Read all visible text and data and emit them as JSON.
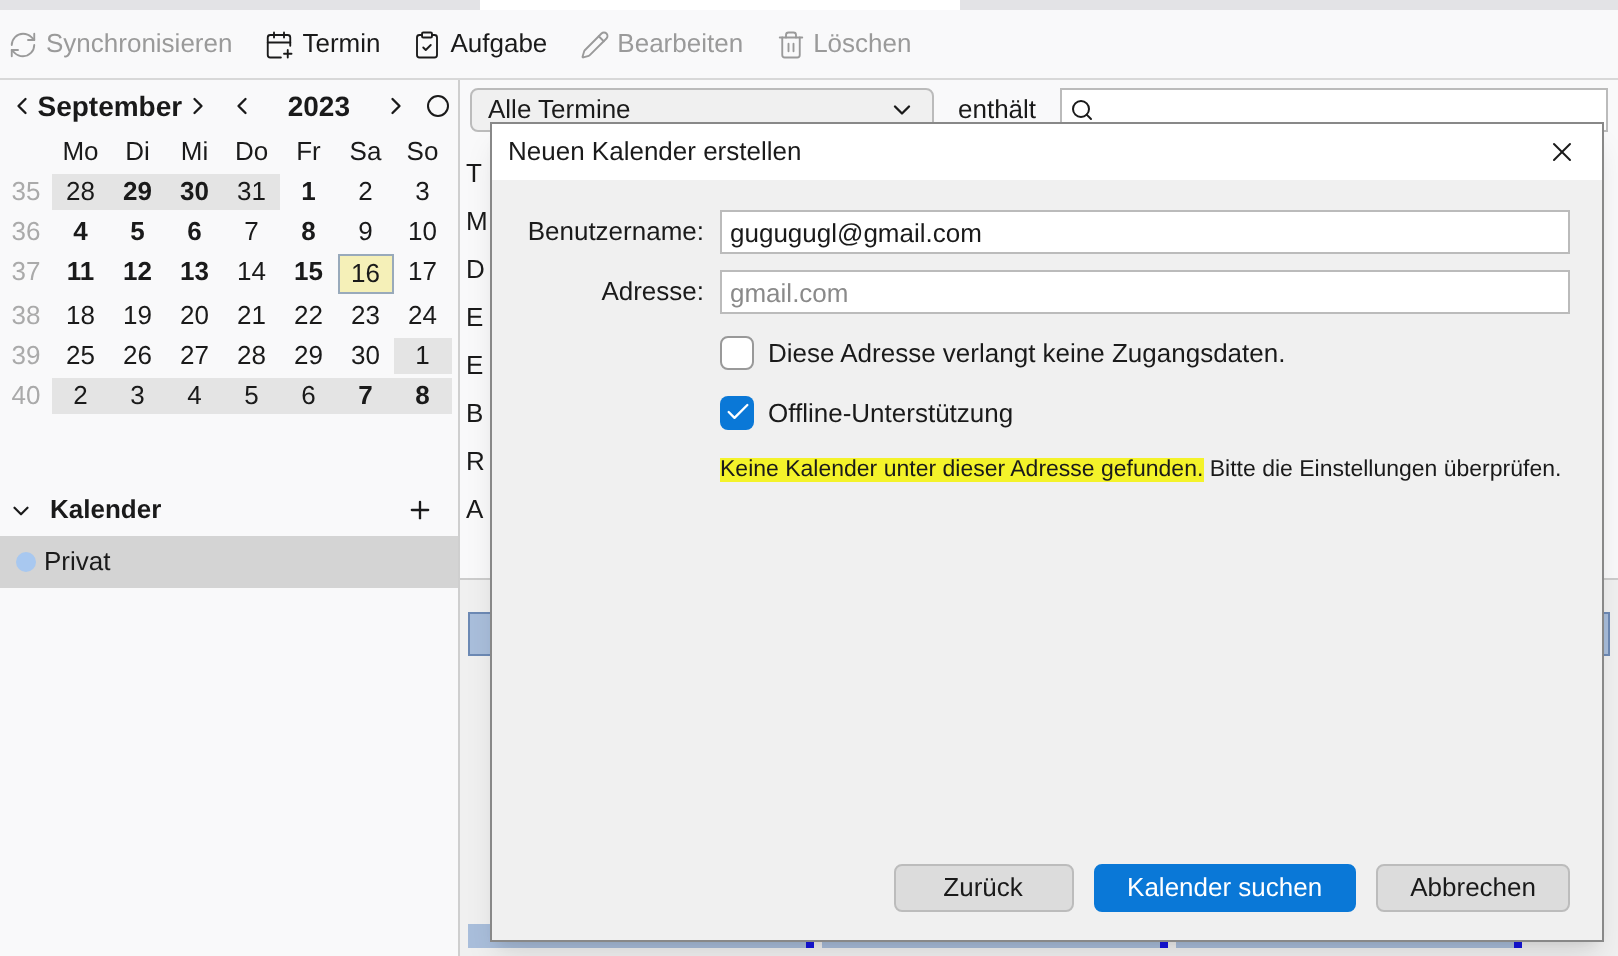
{
  "toolbar": [
    {
      "label": "Synchronisieren",
      "disabled": true
    },
    {
      "label": "Termin",
      "disabled": false
    },
    {
      "label": "Aufgabe",
      "disabled": false
    },
    {
      "label": "Bearbeiten",
      "disabled": true
    },
    {
      "label": "Löschen",
      "disabled": true
    }
  ],
  "minical": {
    "month": "September",
    "year": "2023",
    "weekdays": [
      "Mo",
      "Di",
      "Mi",
      "Do",
      "Fr",
      "Sa",
      "So"
    ],
    "weeks": [
      {
        "number": "35",
        "days": [
          {
            "d": "28",
            "bold": false,
            "other": true,
            "today": false
          },
          {
            "d": "29",
            "bold": true,
            "other": true,
            "today": false
          },
          {
            "d": "30",
            "bold": true,
            "other": true,
            "today": false
          },
          {
            "d": "31",
            "bold": false,
            "other": true,
            "today": false
          },
          {
            "d": "1",
            "bold": true,
            "other": false,
            "today": false
          },
          {
            "d": "2",
            "bold": false,
            "other": false,
            "today": false
          },
          {
            "d": "3",
            "bold": false,
            "other": false,
            "today": false
          }
        ]
      },
      {
        "number": "36",
        "days": [
          {
            "d": "4",
            "bold": true,
            "other": false,
            "today": false
          },
          {
            "d": "5",
            "bold": true,
            "other": false,
            "today": false
          },
          {
            "d": "6",
            "bold": true,
            "other": false,
            "today": false
          },
          {
            "d": "7",
            "bold": false,
            "other": false,
            "today": false
          },
          {
            "d": "8",
            "bold": true,
            "other": false,
            "today": false
          },
          {
            "d": "9",
            "bold": false,
            "other": false,
            "today": false
          },
          {
            "d": "10",
            "bold": false,
            "other": false,
            "today": false
          }
        ]
      },
      {
        "number": "37",
        "days": [
          {
            "d": "11",
            "bold": true,
            "other": false,
            "today": false
          },
          {
            "d": "12",
            "bold": true,
            "other": false,
            "today": false
          },
          {
            "d": "13",
            "bold": true,
            "other": false,
            "today": false
          },
          {
            "d": "14",
            "bold": false,
            "other": false,
            "today": false
          },
          {
            "d": "15",
            "bold": true,
            "other": false,
            "today": false
          },
          {
            "d": "16",
            "bold": false,
            "other": false,
            "today": true
          },
          {
            "d": "17",
            "bold": false,
            "other": false,
            "today": false
          }
        ]
      },
      {
        "number": "38",
        "days": [
          {
            "d": "18",
            "bold": false,
            "other": false,
            "today": false
          },
          {
            "d": "19",
            "bold": false,
            "other": false,
            "today": false
          },
          {
            "d": "20",
            "bold": false,
            "other": false,
            "today": false
          },
          {
            "d": "21",
            "bold": false,
            "other": false,
            "today": false
          },
          {
            "d": "22",
            "bold": false,
            "other": false,
            "today": false
          },
          {
            "d": "23",
            "bold": false,
            "other": false,
            "today": false
          },
          {
            "d": "24",
            "bold": false,
            "other": false,
            "today": false
          }
        ]
      },
      {
        "number": "39",
        "days": [
          {
            "d": "25",
            "bold": false,
            "other": false,
            "today": false
          },
          {
            "d": "26",
            "bold": false,
            "other": false,
            "today": false
          },
          {
            "d": "27",
            "bold": false,
            "other": false,
            "today": false
          },
          {
            "d": "28",
            "bold": false,
            "other": false,
            "today": false
          },
          {
            "d": "29",
            "bold": false,
            "other": false,
            "today": false
          },
          {
            "d": "30",
            "bold": false,
            "other": false,
            "today": false
          },
          {
            "d": "1",
            "bold": false,
            "other": true,
            "today": false
          }
        ]
      },
      {
        "number": "40",
        "days": [
          {
            "d": "2",
            "bold": false,
            "other": true,
            "today": false
          },
          {
            "d": "3",
            "bold": false,
            "other": true,
            "today": false
          },
          {
            "d": "4",
            "bold": false,
            "other": true,
            "today": false
          },
          {
            "d": "5",
            "bold": false,
            "other": true,
            "today": false
          },
          {
            "d": "6",
            "bold": false,
            "other": true,
            "today": false
          },
          {
            "d": "7",
            "bold": true,
            "other": true,
            "today": false
          },
          {
            "d": "8",
            "bold": true,
            "other": true,
            "today": false
          }
        ]
      }
    ]
  },
  "calendars": {
    "title": "Kalender",
    "expanded": true,
    "items": [
      {
        "name": "Privat",
        "color": "#a8c8f0",
        "selected": true
      }
    ]
  },
  "filter": {
    "select": "Alle Termine",
    "label": "enthält"
  },
  "list_fragments": [
    "T",
    "M",
    "D",
    "E",
    "E",
    "B",
    "R",
    "A"
  ],
  "dialog": {
    "title": "Neuen Kalender erstellen",
    "fields": [
      {
        "label": "Benutzername:",
        "value": "gugugugl@gmail.com"
      },
      {
        "label": "Adresse:",
        "placeholder": "gmail.com"
      }
    ],
    "checkboxes": [
      {
        "label": "Diese Adresse verlangt keine Zugangsdaten.",
        "checked": false
      },
      {
        "label": "Offline-Unterstützung",
        "checked": true
      }
    ],
    "message_highlight": "Keine Kalender unter dieser Adresse gefunden.",
    "message_rest": "Bitte die Einstellungen überprüfen.",
    "buttons": [
      {
        "label": "Zurück",
        "primary": false
      },
      {
        "label": "Kalender suchen",
        "primary": true
      },
      {
        "label": "Abbrechen",
        "primary": false
      }
    ]
  }
}
